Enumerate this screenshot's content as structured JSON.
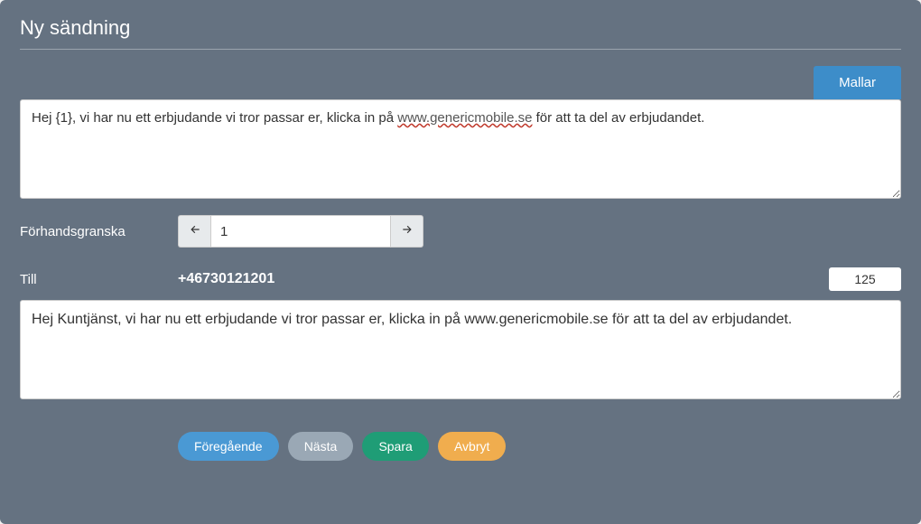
{
  "title": "Ny sändning",
  "mallar_label": "Mallar",
  "template_prefix": "Hej {1}, vi har nu ett erbjudande vi tror passar er, klicka in på ",
  "template_link": "www.genericmobile.se",
  "template_suffix": " för att ta del av erbjudandet.",
  "preview": {
    "label": "Förhandsgranska",
    "value": "1"
  },
  "to": {
    "label": "Till",
    "phone": "+46730121201",
    "char_count": "125"
  },
  "preview_text": "Hej Kuntjänst, vi har nu ett erbjudande vi tror passar er, klicka in på www.genericmobile.se för att ta del av erbjudandet.",
  "actions": {
    "prev": "Föregående",
    "next": "Nästa",
    "save": "Spara",
    "cancel": "Avbryt"
  }
}
